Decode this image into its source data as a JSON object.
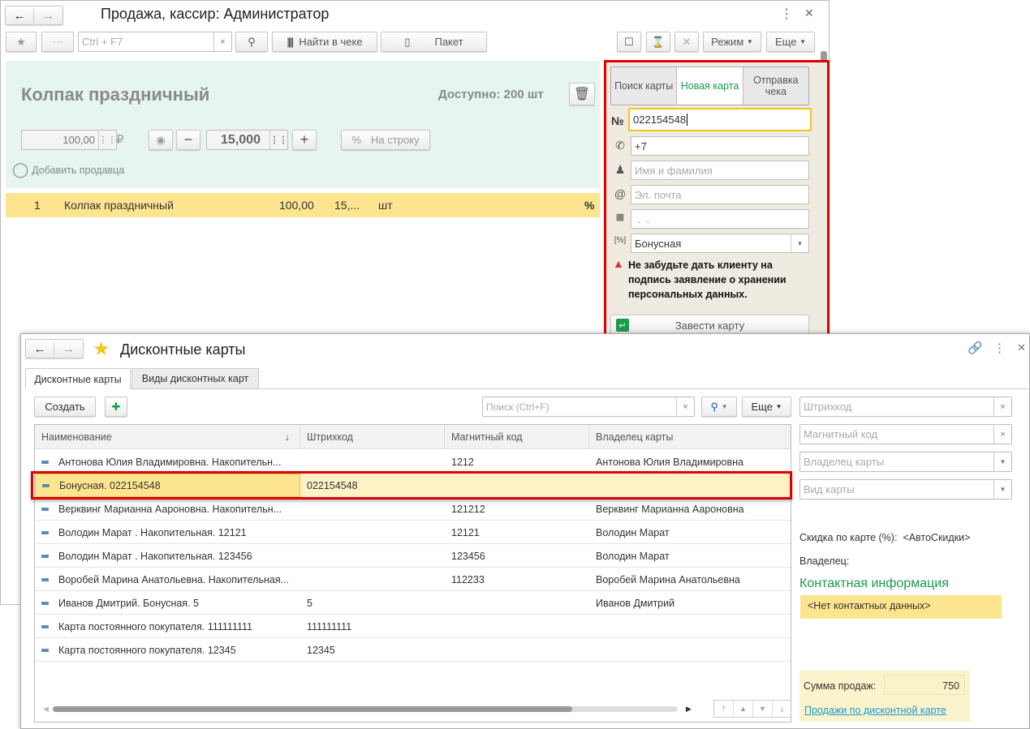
{
  "sale_window": {
    "title": "Продажа, кассир: Администратор",
    "toolbar": {
      "search_placeholder": "Ctrl + F7",
      "find_in_receipt": "Найти в чеке",
      "package": "Пакет",
      "mode": "Режим",
      "more": "Еще"
    },
    "product": {
      "name": "Колпак праздничный",
      "available": "Доступно: 200 шт",
      "price": "100,00",
      "currency": "₽",
      "quantity": "15,000",
      "to_line": "На строку",
      "add_seller": "Добавить продавца"
    },
    "lines": [
      {
        "n": "1",
        "name": "Колпак праздничный",
        "price": "100,00",
        "qty": "15,...",
        "unit": "шт",
        "discount": "%"
      }
    ],
    "card_panel": {
      "tabs": [
        {
          "label": "Поиск карты",
          "active": false
        },
        {
          "label": "Новая карта",
          "active": true
        },
        {
          "label": "Отправка чека",
          "active": false
        }
      ],
      "number_label": "№",
      "number": "022154548",
      "phone": "+7",
      "name_placeholder": "Имя и фамилия",
      "email_placeholder": "Эл. почта",
      "birthday": " .  .",
      "card_type": "Бонусная",
      "warning": "Не забудьте дать клиенту на подпись заявление о хранении персональных данных.",
      "create_button": "Завести карту"
    }
  },
  "cards_window": {
    "title": "Дисконтные карты",
    "tabs": [
      {
        "label": "Дисконтные карты",
        "active": true
      },
      {
        "label": "Виды дисконтных карт",
        "active": false
      }
    ],
    "create_button": "Создать",
    "search_placeholder": "Поиск (Ctrl+F)",
    "more": "Еще",
    "columns": [
      "Наименование",
      "Штрихкод",
      "Магнитный код",
      "Владелец карты"
    ],
    "rows": [
      {
        "name": "Антонова Юлия Владимировна. Накопительн...",
        "barcode": "",
        "magnetic": "1212",
        "owner": "Антонова Юлия Владимировна"
      },
      {
        "name": "Бонусная. 022154548",
        "barcode": "022154548",
        "magnetic": "",
        "owner": "",
        "selected": true
      },
      {
        "name": "Верквинг Марианна Аароновна. Накопительн...",
        "barcode": "",
        "magnetic": "121212",
        "owner": "Верквинг Марианна Аароновна"
      },
      {
        "name": "Володин Марат . Накопительная. 12121",
        "barcode": "",
        "magnetic": "12121",
        "owner": "Володин Марат"
      },
      {
        "name": "Володин Марат . Накопительная. 123456",
        "barcode": "",
        "magnetic": "123456",
        "owner": "Володин Марат"
      },
      {
        "name": "Воробей Марина Анатольевна. Накопительная...",
        "barcode": "",
        "magnetic": "112233",
        "owner": "Воробей Марина Анатольевна"
      },
      {
        "name": "Иванов Дмитрий. Бонусная. 5",
        "barcode": "5",
        "magnetic": "",
        "owner": "Иванов Дмитрий"
      },
      {
        "name": "Карта постоянного покупателя. 111111111",
        "barcode": "111111111",
        "magnetic": "",
        "owner": ""
      },
      {
        "name": "Карта постоянного покупателя. 12345",
        "barcode": "12345",
        "magnetic": "",
        "owner": ""
      }
    ],
    "filters": {
      "barcode": "Штрихкод",
      "magnetic": "Магнитный код",
      "owner": "Владелец карты",
      "card_type": "Вид карты"
    },
    "discount_label": "Скидка по карте (%):",
    "discount_value": "<АвтоСкидки>",
    "owner_label": "Владелец:",
    "contact_title": "Контактная информация",
    "contact_value": "<Нет контактных данных>",
    "sales_label": "Сумма продаж:",
    "sales_value": "750",
    "sales_link": "Продажи по дисконтной карте"
  },
  "colors": {
    "highlight": "#fde58f",
    "accent_green": "#1a9a4a",
    "red_frame": "#e00000",
    "panel_bg": "#e6f5ee"
  }
}
